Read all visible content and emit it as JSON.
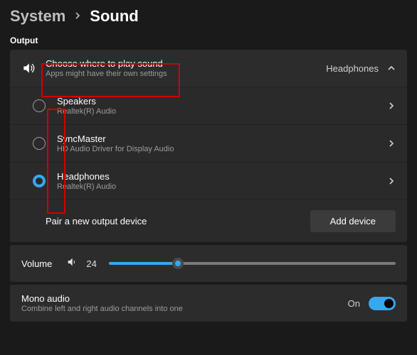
{
  "breadcrumb": {
    "parent": "System",
    "current": "Sound"
  },
  "output": {
    "section_label": "Output",
    "header": {
      "title": "Choose where to play sound",
      "subtitle": "Apps might have their own settings",
      "current_device": "Headphones"
    },
    "devices": [
      {
        "name": "Speakers",
        "driver": "Realtek(R) Audio",
        "selected": false
      },
      {
        "name": "SyncMaster",
        "driver": "HD Audio Driver for Display Audio",
        "selected": false
      },
      {
        "name": "Headphones",
        "driver": "Realtek(R) Audio",
        "selected": true
      }
    ],
    "pair": {
      "label": "Pair a new output device",
      "button": "Add device"
    }
  },
  "volume": {
    "label": "Volume",
    "value": "24",
    "percent": 24
  },
  "mono": {
    "title": "Mono audio",
    "subtitle": "Combine left and right audio channels into one",
    "state_label": "On"
  },
  "colors": {
    "accent": "#39a7ee"
  }
}
